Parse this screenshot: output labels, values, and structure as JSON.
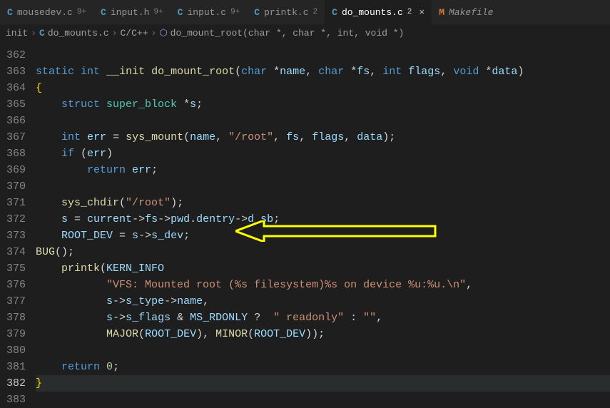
{
  "tabs": [
    {
      "icon": "C",
      "name": "mousedev.c",
      "badge": "9+"
    },
    {
      "icon": "C",
      "name": "input.h",
      "badge": "9+"
    },
    {
      "icon": "C",
      "name": "input.c",
      "badge": "9+"
    },
    {
      "icon": "C",
      "name": "printk.c",
      "badge": "2"
    },
    {
      "icon": "C",
      "name": "do_mounts.c",
      "badge": "2",
      "active": true
    },
    {
      "icon": "M",
      "name": "Makefile",
      "badge": ""
    }
  ],
  "breadcrumb": {
    "folder": "init",
    "file": "do_mounts.c",
    "lang": "C/C++",
    "symbol": "do_mount_root(char *, char *, int, void *)"
  },
  "lines": {
    "start": 362,
    "current": 382,
    "nums": [
      "362",
      "363",
      "364",
      "365",
      "366",
      "367",
      "368",
      "369",
      "370",
      "371",
      "372",
      "373",
      "374",
      "375",
      "376",
      "377",
      "378",
      "379",
      "380",
      "381",
      "382",
      "383"
    ]
  },
  "code": {
    "l363": {
      "kw1": "static",
      "kw2": "int",
      "kw3": "__init",
      "fn": "do_mount_root",
      "kw4": "char",
      "p1": "name",
      "kw5": "char",
      "p2": "fs",
      "kw6": "int",
      "p3": "flags",
      "kw7": "void",
      "p4": "data"
    },
    "l364": "{",
    "l365": {
      "kw": "struct",
      "ty": "super_block",
      "id": "s"
    },
    "l367": {
      "kw": "int",
      "id": "err",
      "fn": "sys_mount",
      "a1": "name",
      "s": "\"/root\"",
      "a2": "fs",
      "a3": "flags",
      "a4": "data"
    },
    "l368": {
      "kw": "if",
      "id": "err"
    },
    "l369": {
      "kw": "return",
      "id": "err"
    },
    "l371": {
      "fn": "sys_chdir",
      "s": "\"/root\""
    },
    "l372": {
      "id": "s",
      "a": "current",
      "b": "fs",
      "c": "pwd",
      "d": "dentry",
      "e": "d_sb"
    },
    "l373": {
      "mac": "ROOT_DEV",
      "id": "s",
      "f": "s_dev"
    },
    "l374": {
      "mac": "BUG"
    },
    "l375": {
      "fn": "printk",
      "mac": "KERN_INFO"
    },
    "l376": {
      "s": "\"VFS: Mounted root (%s filesystem)%s on device %u:%u.\\n\""
    },
    "l377": {
      "id": "s",
      "f": "s_type",
      "g": "name"
    },
    "l378": {
      "id": "s",
      "f": "s_flags",
      "mac": "MS_RDONLY",
      "s1": "\" readonly\"",
      "s2": "\"\""
    },
    "l379": {
      "fn1": "MAJOR",
      "mac": "ROOT_DEV",
      "fn2": "MINOR"
    },
    "l381": {
      "kw": "return",
      "n": "0"
    },
    "l382": "}"
  }
}
